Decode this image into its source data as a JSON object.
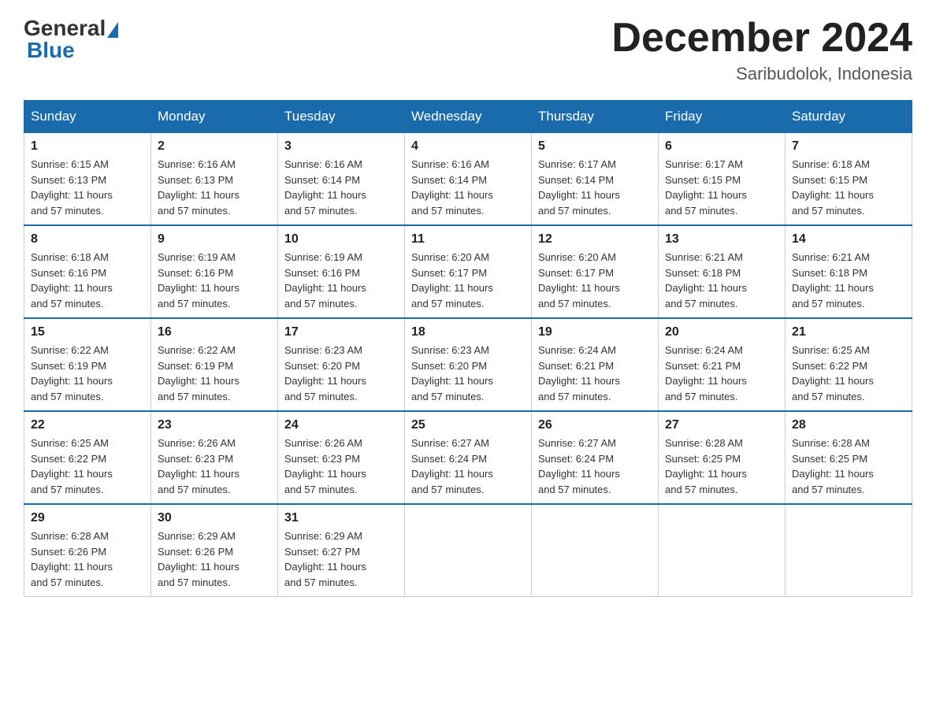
{
  "header": {
    "logo_general": "General",
    "logo_blue": "Blue",
    "month_title": "December 2024",
    "location": "Saribudolok, Indonesia"
  },
  "days_of_week": [
    "Sunday",
    "Monday",
    "Tuesday",
    "Wednesday",
    "Thursday",
    "Friday",
    "Saturday"
  ],
  "weeks": [
    [
      {
        "day": "1",
        "sunrise": "6:15 AM",
        "sunset": "6:13 PM",
        "daylight": "11 hours and 57 minutes."
      },
      {
        "day": "2",
        "sunrise": "6:16 AM",
        "sunset": "6:13 PM",
        "daylight": "11 hours and 57 minutes."
      },
      {
        "day": "3",
        "sunrise": "6:16 AM",
        "sunset": "6:14 PM",
        "daylight": "11 hours and 57 minutes."
      },
      {
        "day": "4",
        "sunrise": "6:16 AM",
        "sunset": "6:14 PM",
        "daylight": "11 hours and 57 minutes."
      },
      {
        "day": "5",
        "sunrise": "6:17 AM",
        "sunset": "6:14 PM",
        "daylight": "11 hours and 57 minutes."
      },
      {
        "day": "6",
        "sunrise": "6:17 AM",
        "sunset": "6:15 PM",
        "daylight": "11 hours and 57 minutes."
      },
      {
        "day": "7",
        "sunrise": "6:18 AM",
        "sunset": "6:15 PM",
        "daylight": "11 hours and 57 minutes."
      }
    ],
    [
      {
        "day": "8",
        "sunrise": "6:18 AM",
        "sunset": "6:16 PM",
        "daylight": "11 hours and 57 minutes."
      },
      {
        "day": "9",
        "sunrise": "6:19 AM",
        "sunset": "6:16 PM",
        "daylight": "11 hours and 57 minutes."
      },
      {
        "day": "10",
        "sunrise": "6:19 AM",
        "sunset": "6:16 PM",
        "daylight": "11 hours and 57 minutes."
      },
      {
        "day": "11",
        "sunrise": "6:20 AM",
        "sunset": "6:17 PM",
        "daylight": "11 hours and 57 minutes."
      },
      {
        "day": "12",
        "sunrise": "6:20 AM",
        "sunset": "6:17 PM",
        "daylight": "11 hours and 57 minutes."
      },
      {
        "day": "13",
        "sunrise": "6:21 AM",
        "sunset": "6:18 PM",
        "daylight": "11 hours and 57 minutes."
      },
      {
        "day": "14",
        "sunrise": "6:21 AM",
        "sunset": "6:18 PM",
        "daylight": "11 hours and 57 minutes."
      }
    ],
    [
      {
        "day": "15",
        "sunrise": "6:22 AM",
        "sunset": "6:19 PM",
        "daylight": "11 hours and 57 minutes."
      },
      {
        "day": "16",
        "sunrise": "6:22 AM",
        "sunset": "6:19 PM",
        "daylight": "11 hours and 57 minutes."
      },
      {
        "day": "17",
        "sunrise": "6:23 AM",
        "sunset": "6:20 PM",
        "daylight": "11 hours and 57 minutes."
      },
      {
        "day": "18",
        "sunrise": "6:23 AM",
        "sunset": "6:20 PM",
        "daylight": "11 hours and 57 minutes."
      },
      {
        "day": "19",
        "sunrise": "6:24 AM",
        "sunset": "6:21 PM",
        "daylight": "11 hours and 57 minutes."
      },
      {
        "day": "20",
        "sunrise": "6:24 AM",
        "sunset": "6:21 PM",
        "daylight": "11 hours and 57 minutes."
      },
      {
        "day": "21",
        "sunrise": "6:25 AM",
        "sunset": "6:22 PM",
        "daylight": "11 hours and 57 minutes."
      }
    ],
    [
      {
        "day": "22",
        "sunrise": "6:25 AM",
        "sunset": "6:22 PM",
        "daylight": "11 hours and 57 minutes."
      },
      {
        "day": "23",
        "sunrise": "6:26 AM",
        "sunset": "6:23 PM",
        "daylight": "11 hours and 57 minutes."
      },
      {
        "day": "24",
        "sunrise": "6:26 AM",
        "sunset": "6:23 PM",
        "daylight": "11 hours and 57 minutes."
      },
      {
        "day": "25",
        "sunrise": "6:27 AM",
        "sunset": "6:24 PM",
        "daylight": "11 hours and 57 minutes."
      },
      {
        "day": "26",
        "sunrise": "6:27 AM",
        "sunset": "6:24 PM",
        "daylight": "11 hours and 57 minutes."
      },
      {
        "day": "27",
        "sunrise": "6:28 AM",
        "sunset": "6:25 PM",
        "daylight": "11 hours and 57 minutes."
      },
      {
        "day": "28",
        "sunrise": "6:28 AM",
        "sunset": "6:25 PM",
        "daylight": "11 hours and 57 minutes."
      }
    ],
    [
      {
        "day": "29",
        "sunrise": "6:28 AM",
        "sunset": "6:26 PM",
        "daylight": "11 hours and 57 minutes."
      },
      {
        "day": "30",
        "sunrise": "6:29 AM",
        "sunset": "6:26 PM",
        "daylight": "11 hours and 57 minutes."
      },
      {
        "day": "31",
        "sunrise": "6:29 AM",
        "sunset": "6:27 PM",
        "daylight": "11 hours and 57 minutes."
      },
      null,
      null,
      null,
      null
    ]
  ]
}
